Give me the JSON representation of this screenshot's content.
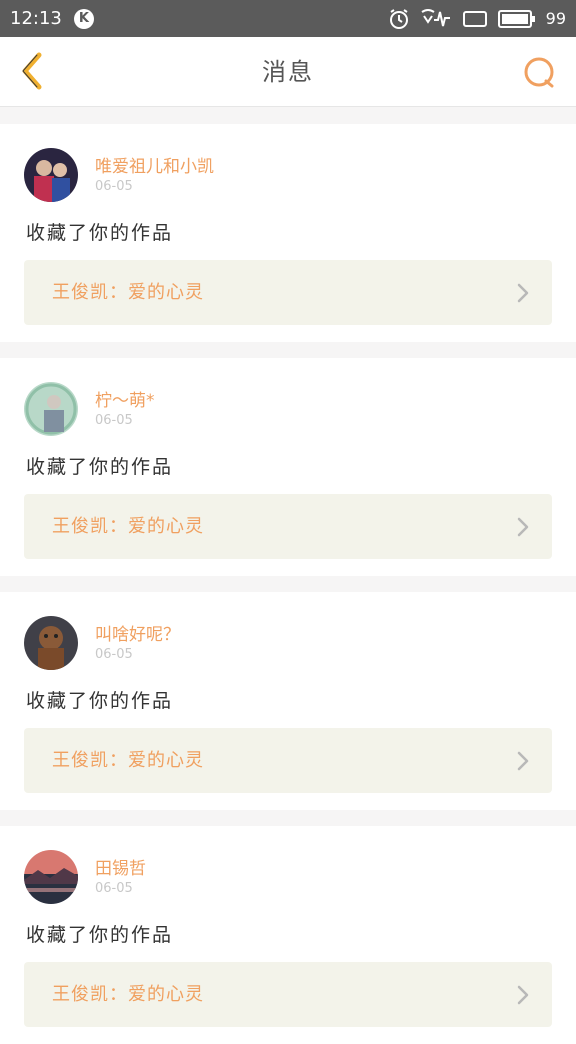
{
  "status_bar": {
    "time": "12:13",
    "badge": "K",
    "battery": "99"
  },
  "header": {
    "title": "消息",
    "back_icon": "chevron-left-icon",
    "search_icon": "search-icon",
    "accent_color": "#f0a060"
  },
  "messages": [
    {
      "username": "唯爱祖儿和小凯",
      "date": "06-05",
      "text": "收藏了你的作品",
      "work_title": "王俊凯：爱的心灵"
    },
    {
      "username": "柠～萌*",
      "date": "06-05",
      "text": "收藏了你的作品",
      "work_title": "王俊凯：爱的心灵"
    },
    {
      "username": "叫啥好呢？",
      "date": "06-05",
      "text": "收藏了你的作品",
      "work_title": "王俊凯：爱的心灵"
    },
    {
      "username": "田锡哲",
      "date": "06-05",
      "text": "收藏了你的作品",
      "work_title": "王俊凯：爱的心灵"
    }
  ]
}
